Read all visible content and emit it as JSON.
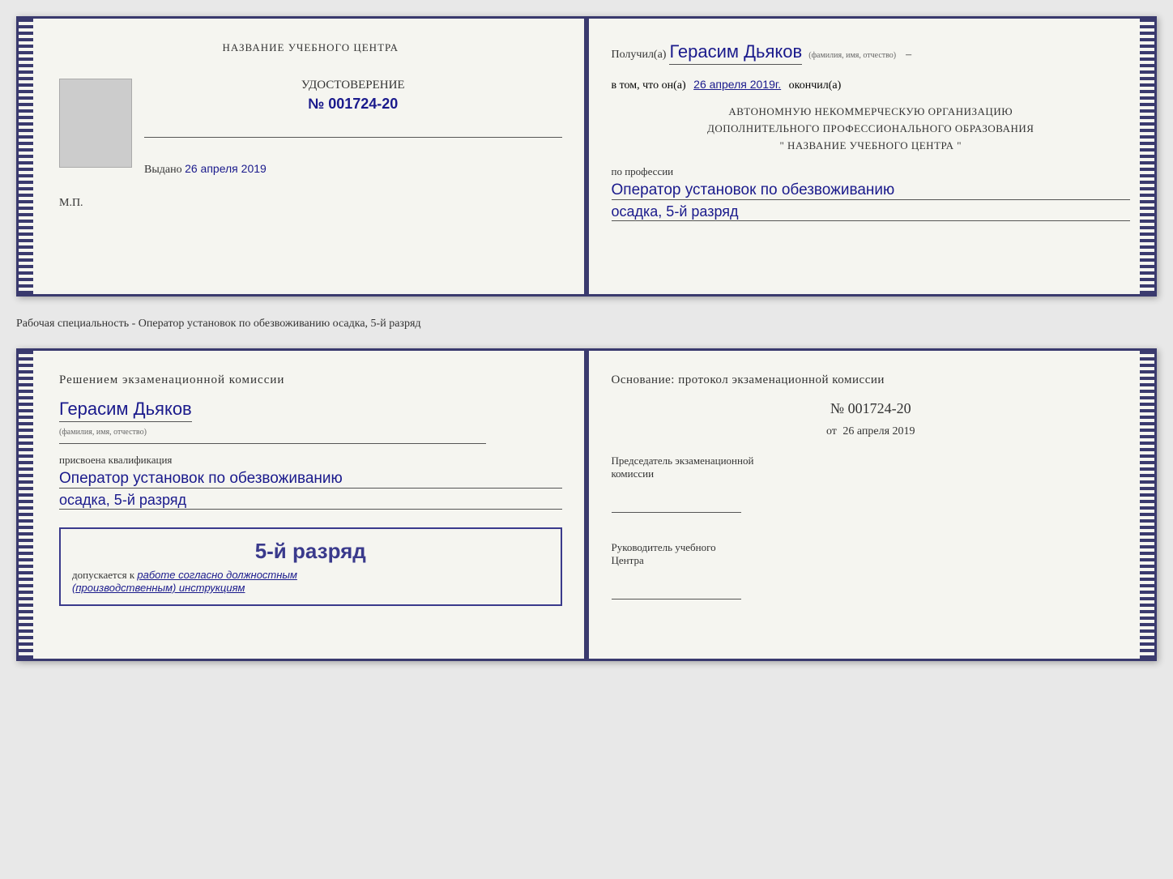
{
  "top_book": {
    "left_page": {
      "center_name": "НАЗВАНИЕ УЧЕБНОГО ЦЕНТРА",
      "certificate_title": "УДОСТОВЕРЕНИЕ",
      "certificate_number": "№ 001724-20",
      "issued_label": "Выдано",
      "issued_date": "26 апреля 2019",
      "mp_label": "М.П."
    },
    "right_page": {
      "received_label": "Получил(а)",
      "recipient_name": "Герасим Дьяков",
      "fio_sublabel": "(фамилия, имя, отчество)",
      "date_preamble": "в том, что он(а)",
      "date_handwritten": "26 апреля 2019г.",
      "date_suffix": "окончил(а)",
      "org_line1": "АВТОНОМНУЮ НЕКОММЕРЧЕСКУЮ ОРГАНИЗАЦИЮ",
      "org_line2": "ДОПОЛНИТЕЛЬНОГО ПРОФЕССИОНАЛЬНОГО ОБРАЗОВАНИЯ",
      "org_line3": "\" НАЗВАНИЕ УЧЕБНОГО ЦЕНТРА \"",
      "profession_label": "по профессии",
      "profession_handwritten": "Оператор установок по обезвоживанию",
      "rank_handwritten": "осадка, 5-й разряд"
    }
  },
  "separator_text": "Рабочая специальность - Оператор установок по обезвоживанию осадка, 5-й разряд",
  "bottom_book": {
    "left_page": {
      "decision_title": "Решением экзаменационной комиссии",
      "person_name": "Герасим Дьяков",
      "fio_sublabel": "(фамилия, имя, отчество)",
      "qualification_label": "присвоена квалификация",
      "qualification_name1": "Оператор установок по обезвоживанию",
      "qualification_name2": "осадка, 5-й разряд",
      "stamp_rank": "5-й разряд",
      "stamp_prefix": "допускается к",
      "stamp_italic": "работе согласно должностным",
      "stamp_italic2": "(производственным) инструкциям"
    },
    "right_page": {
      "basis_title": "Основание: протокол экзаменационной комиссии",
      "protocol_number": "№ 001724-20",
      "date_prefix": "от",
      "date_value": "26 апреля 2019",
      "chairman_label": "Председатель экзаменационной",
      "chairman_label2": "комиссии",
      "director_label": "Руководитель учебного",
      "director_label2": "Центра"
    }
  }
}
